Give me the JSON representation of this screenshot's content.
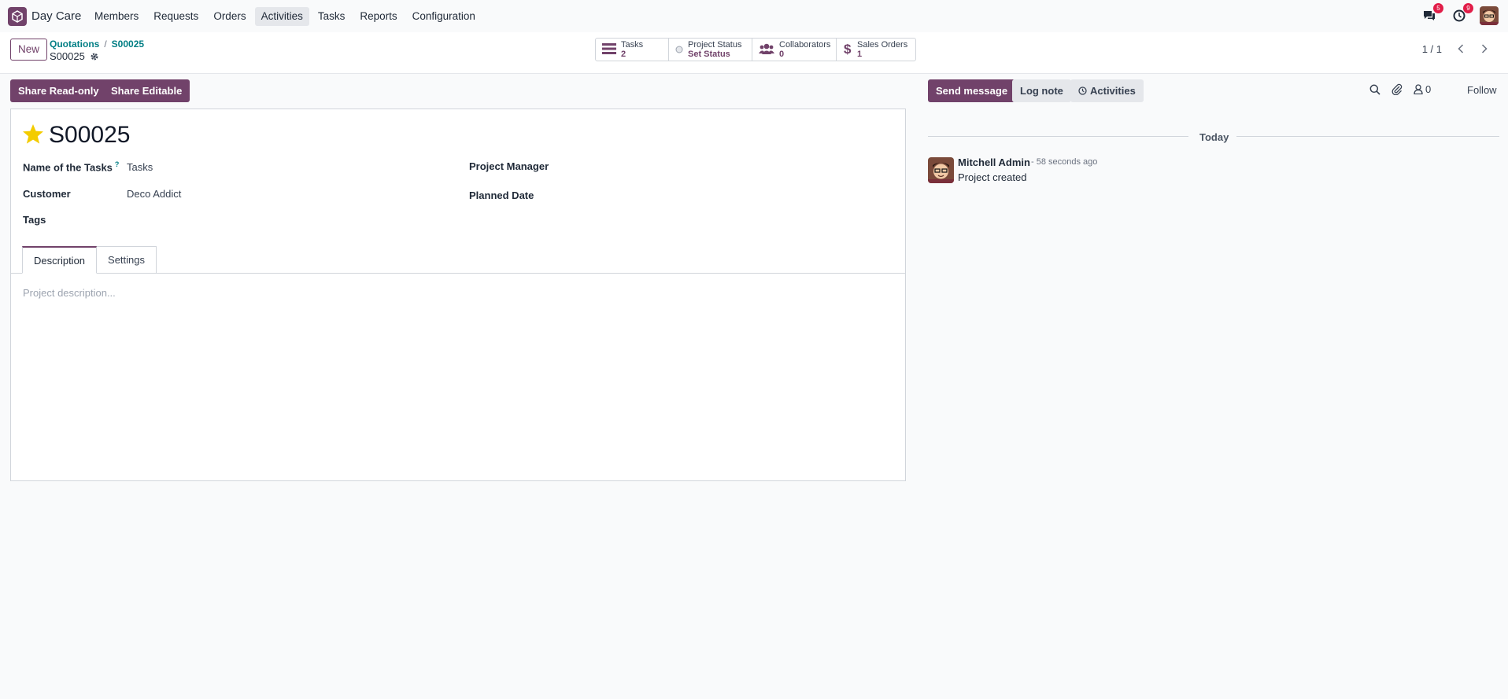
{
  "app": {
    "name": "Day Care",
    "icon": "cube-app-icon"
  },
  "menu": {
    "items": [
      {
        "label": "Members"
      },
      {
        "label": "Requests"
      },
      {
        "label": "Orders"
      },
      {
        "label": "Activities",
        "active": true
      },
      {
        "label": "Tasks"
      },
      {
        "label": "Reports"
      },
      {
        "label": "Configuration"
      }
    ]
  },
  "systray": {
    "messages_count": "5",
    "activities_count": "9"
  },
  "control": {
    "new_label": "New",
    "breadcrumb": [
      "Quotations",
      "S00025"
    ],
    "record_name": "S00025",
    "pager": "1 / 1"
  },
  "stats": {
    "tasks": {
      "label": "Tasks",
      "value": "2"
    },
    "status": {
      "label": "Project Status",
      "value": "Set Status"
    },
    "collaborators": {
      "label": "Collaborators",
      "value": "0"
    },
    "sales": {
      "label": "Sales Orders",
      "value": "1"
    }
  },
  "actions": {
    "share_readonly": "Share Read-only",
    "share_editable": "Share Editable"
  },
  "form": {
    "title": "S00025",
    "favorite": true,
    "fields": {
      "tasks_name_label": "Name of the Tasks",
      "tasks_name_help": "?",
      "tasks_name_value": "Tasks",
      "customer_label": "Customer",
      "customer_value": "Deco Addict",
      "tags_label": "Tags",
      "manager_label": "Project Manager",
      "planned_label": "Planned Date"
    },
    "tabs": [
      "Description",
      "Settings"
    ],
    "description_placeholder": "Project description..."
  },
  "chatter": {
    "send_message": "Send message",
    "log_note": "Log note",
    "activities": "Activities",
    "followers_count": "0",
    "follow": "Follow",
    "day_label": "Today",
    "message": {
      "author": "Mitchell Admin",
      "time": "- 58 seconds ago",
      "body": "Project created"
    }
  },
  "colors": {
    "brand": "#71426a",
    "link": "#017e84",
    "star": "#f3cc00",
    "badge": "#e11d48"
  }
}
